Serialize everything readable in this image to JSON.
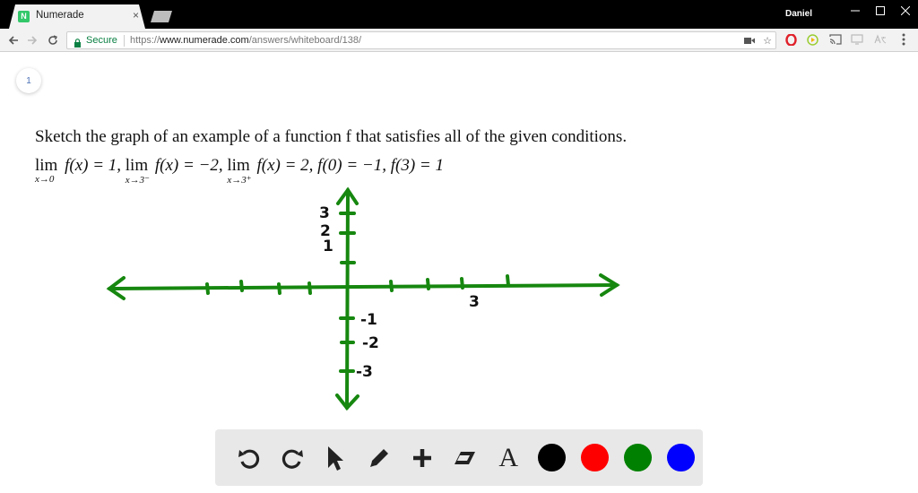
{
  "browser": {
    "tab": {
      "favicon": "N",
      "title": "Numerade",
      "close": "×"
    },
    "user": "Daniel",
    "omnibox": {
      "secure": "Secure",
      "url_scheme": "https://",
      "url_host": "www.numerade.com",
      "url_path": "/answers/whiteboard/138/"
    },
    "icons": {
      "back": "back-arrow-icon",
      "forward": "forward-arrow-icon",
      "reload": "reload-icon",
      "lock": "lock-icon",
      "camera": "camera-icon",
      "star": "star-icon",
      "opera": "opera-icon",
      "play": "play-icon",
      "cast": "cast-icon",
      "monitor": "monitor-icon",
      "translate": "translate-icon",
      "menu": "more-menu-icon"
    }
  },
  "page": {
    "badge": "1",
    "question": "Sketch the graph of an example of a function f that satisfies all of the given conditions.",
    "conditions": {
      "lim1_sub": "x→0",
      "expr1": "f(x) = 1,",
      "lim2_sub": "x→3⁻",
      "expr2": "f(x) = −2,",
      "lim3_sub": "x→3⁺",
      "expr3": "f(x) = 2, f(0) = −1, f(3) = 1",
      "lim_word": "lim"
    }
  },
  "whiteboard": {
    "ink_color": "#16870f",
    "y_labels_top": [
      "3",
      "2",
      "1"
    ],
    "y_labels_bottom": [
      "-1",
      "-2",
      "-3"
    ],
    "x_label": "3"
  },
  "palette": {
    "tools": [
      "undo-icon",
      "redo-icon",
      "pointer-icon",
      "pencil-icon",
      "plus-icon",
      "eraser-icon",
      "text-tool-icon"
    ],
    "text_tool": "A",
    "colors": [
      "#000000",
      "#ff0000",
      "#008000",
      "#0000ff"
    ]
  }
}
